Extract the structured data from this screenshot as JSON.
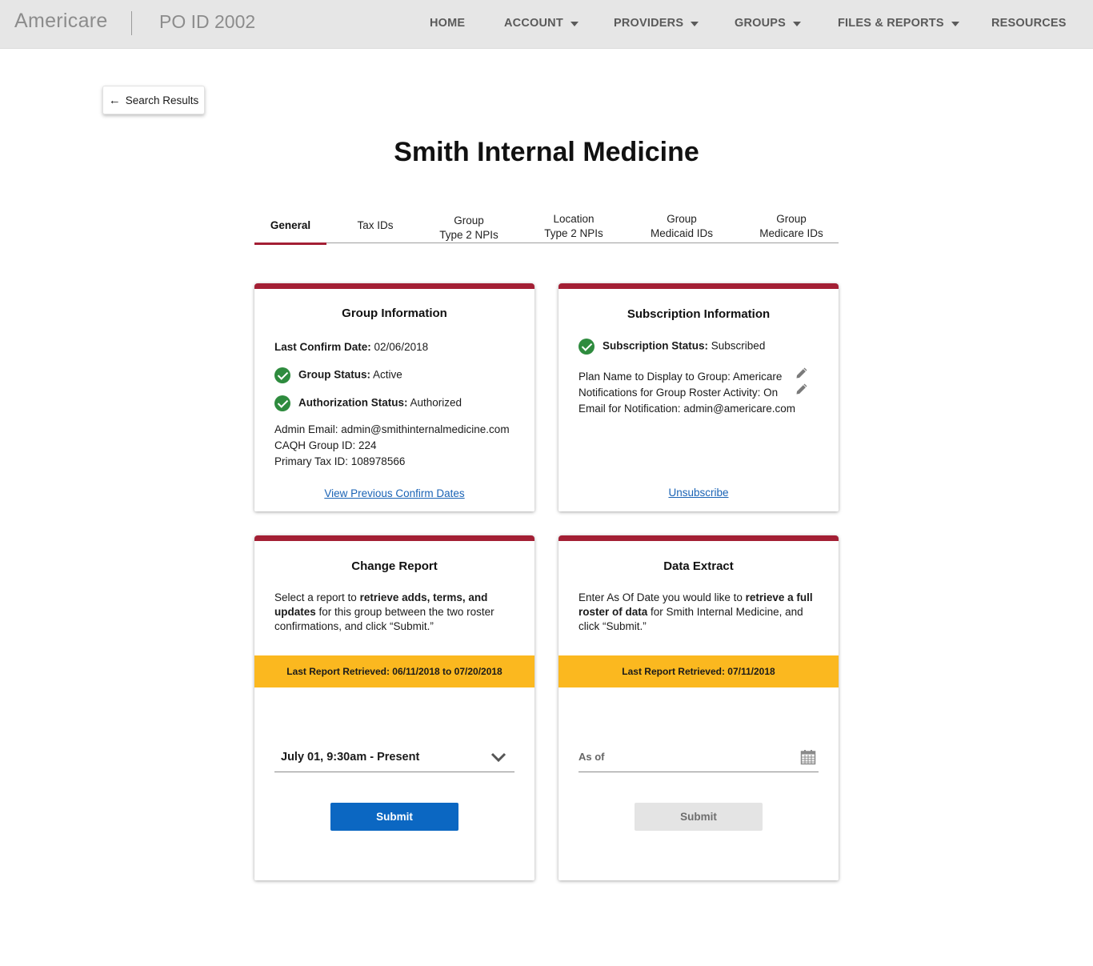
{
  "header": {
    "brand": "Americare",
    "po_id": "PO ID 2002",
    "nav": {
      "home": "HOME",
      "account": "ACCOUNT",
      "providers": "PROVIDERS",
      "groups": "GROUPS",
      "files_reports": "FILES & REPORTS",
      "resources": "RESOURCES"
    }
  },
  "back_button": {
    "label": "Search Results"
  },
  "page_title": "Smith Internal Medicine",
  "tabs": {
    "general": "General",
    "tax_ids": "Tax IDs",
    "group_npis_1": "Group",
    "group_npis_2": "Type 2 NPIs",
    "location_npis_1": "Location",
    "location_npis_2": "Type 2 NPIs",
    "medicaid_1": "Group",
    "medicaid_2": "Medicaid IDs",
    "medicare_1": "Group",
    "medicare_2": "Medicare IDs"
  },
  "group_info": {
    "title": "Group Information",
    "last_confirm_label": "Last Confirm Date:",
    "last_confirm_value": "02/06/2018",
    "group_status_label": "Group Status:",
    "group_status_value": "Active",
    "auth_status_label": "Authorization Status:",
    "auth_status_value": "Authorized",
    "admin_email": "Admin Email: admin@smithinternalmedicine.com",
    "caqh_id": "CAQH Group ID: 224",
    "primary_tax_id": "Primary Tax ID: 108978566",
    "view_link": "View Previous Confirm Dates"
  },
  "subscription_info": {
    "title": "Subscription Information",
    "status_label": "Subscription Status:",
    "status_value": "Subscribed",
    "plan_name": "Plan Name to Display to Group: Americare",
    "notifications": "Notifications for Group Roster Activity: On",
    "email": "Email for Notification: admin@americare.com",
    "unsubscribe_link": "Unsubscribe"
  },
  "change_report": {
    "title": "Change Report",
    "desc_1": "Select a report to ",
    "desc_bold": "retrieve adds, terms, and updates",
    "desc_2": " for this group between the two roster confirmations, and click “Submit.”",
    "banner": "Last Report Retrieved: 06/11/2018 to 07/20/2018",
    "selected_option": "July 01, 9:30am - Present",
    "submit_label": "Submit"
  },
  "data_extract": {
    "title": "Data Extract",
    "desc_1": "Enter As Of Date you would like to ",
    "desc_bold": "retrieve a full roster of data",
    "desc_2": " for Smith Internal Medicine, and click “Submit.”",
    "banner": "Last Report Retrieved: 07/11/2018",
    "as_of_placeholder": "As of",
    "submit_label": "Submit"
  },
  "colors": {
    "accent_red": "#a31f34",
    "banner_yellow": "#fbb81f",
    "primary_blue": "#0b67c2",
    "success_green": "#2e8b3e"
  }
}
